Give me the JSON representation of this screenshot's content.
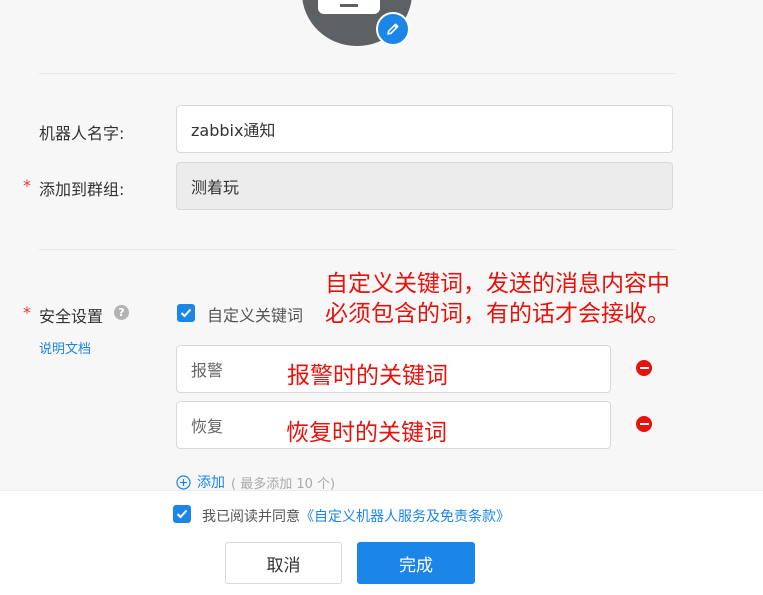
{
  "form": {
    "robot_name_label": "机器人名字:",
    "robot_name_value": "zabbix通知",
    "group_label": "添加到群组:",
    "group_value": "测着玩",
    "required_mark": "*",
    "security_label": "安全设置",
    "help_glyph": "?",
    "doc_link": "说明文档",
    "custom_keyword_label": "自定义关键词",
    "keywords": [
      "报警",
      "恢复"
    ],
    "add_label": "添加",
    "add_hint": "( 最多添加 10 个)"
  },
  "annotations": {
    "security_note_line1": "自定义关键词，发送的消息内容中",
    "security_note_line2": "必须包含的词，有的话才会接收。",
    "alarm_note": "报警时的关键词",
    "recover_note": "恢复时的关键词"
  },
  "footer": {
    "agree_prefix": "我已阅读并同意",
    "agree_link": "《自定义机器人服务及免责条款》",
    "cancel": "取消",
    "done": "完成"
  },
  "colors": {
    "accent": "#1b86e8",
    "annotation_red": "#e8120c"
  }
}
